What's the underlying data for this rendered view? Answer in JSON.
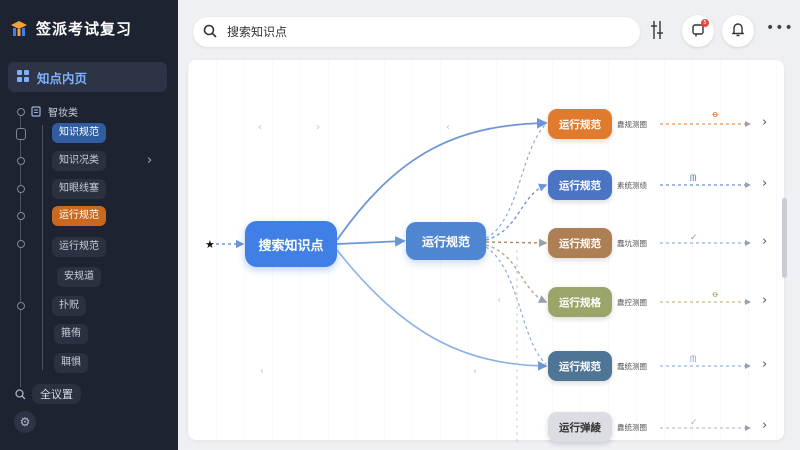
{
  "app": {
    "title": "签派考试复习"
  },
  "sidebar": {
    "section": "知点内页",
    "root": "智妆类",
    "items": [
      "知识规范",
      "知识况类",
      "知眼线塞",
      "运行规范",
      "运行规范",
      "安规道",
      "扑贶",
      "箍侑",
      "聑惧"
    ],
    "search_label": "全议置"
  },
  "search": {
    "placeholder": "搜索知识点"
  },
  "notifications": {
    "badge": "5"
  },
  "colors": {
    "accent": "#3f7fe6",
    "leaf_colors": [
      "#e07a2c",
      "#4a74c4",
      "#ad7f55",
      "#9aa56a",
      "#4f7596",
      "#dcdde3"
    ]
  },
  "graph": {
    "root": "搜索知识点",
    "mid": "运行规范",
    "leaves": [
      {
        "label": "运行规范",
        "note": "纛规测圈",
        "decor": "ꝋ"
      },
      {
        "label": "运行规范",
        "note": "素统测绩",
        "decor": "ᗰ"
      },
      {
        "label": "运行规范",
        "note": "蠢坑测圈",
        "decor": "✓"
      },
      {
        "label": "运行规格",
        "note": "纛控测圈",
        "decor": "ꝋ"
      },
      {
        "label": "运行规范",
        "note": "蠢统测圈",
        "decor": "ᗰ"
      },
      {
        "label": "运行弹綾",
        "note": "纛统测圈",
        "decor": "✓"
      }
    ]
  }
}
